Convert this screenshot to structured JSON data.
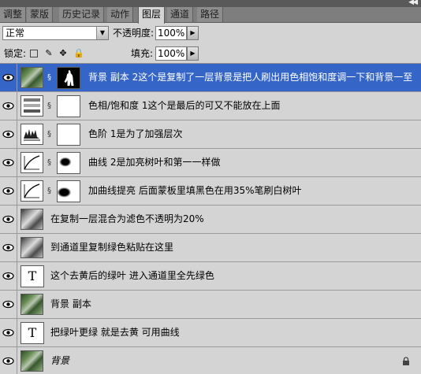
{
  "tabs": [
    "调整",
    "蒙版",
    "历史记录",
    "动作",
    "图层",
    "通道",
    "路径"
  ],
  "active_tab": "图层",
  "blend": {
    "mode": "正常",
    "opacity_label": "不透明度:",
    "opacity_value": "100%"
  },
  "lock": {
    "label": "锁定:",
    "fill_label": "填充:",
    "fill_value": "100%"
  },
  "layers": [
    {
      "name": "背景 副本 2这个是复制了一层背景是把人刷出用色相饱和度调一下和背景一至",
      "selected": true
    },
    {
      "name": "色相/饱和度 1这个是最后的可又不能放在上面"
    },
    {
      "name": "色阶 1是为了加强层次"
    },
    {
      "name": "曲线 2是加亮树叶和第一一样做"
    },
    {
      "name": "加曲线提亮 后面蒙板里填黑色在用35%笔刷白树叶"
    },
    {
      "name": "在复制一层混合为滤色不透明为20%"
    },
    {
      "name": "到通道里复制绿色粘贴在这里"
    },
    {
      "name": "这个去黄后的绿叶 进入通道里全先绿色"
    },
    {
      "name": "背景 副本"
    },
    {
      "name": "把绿叶更绿 就是去黄 可用曲线"
    },
    {
      "name": "背景",
      "locked": true
    }
  ],
  "colors": {
    "selected": "#3565c6",
    "panel": "#d4d4d4"
  }
}
